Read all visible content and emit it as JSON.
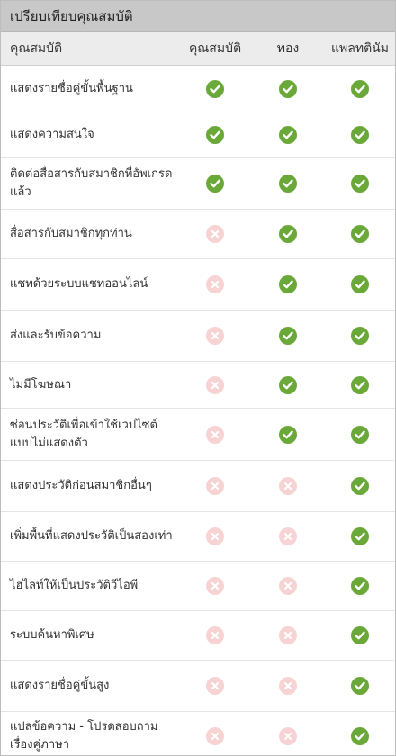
{
  "title": "เปรียบเทียบคุณสมบัติ",
  "columns": [
    "คุณสมบัติ",
    "คุณสมบัติ",
    "ทอง",
    "แพลทตินัม"
  ],
  "colors": {
    "header_bg": "#c8c8c8",
    "check": "#6aa83a",
    "cross": "#f7d3d3"
  },
  "icons": {
    "yes": "check-circle-icon",
    "no": "cross-circle-icon"
  },
  "rows": [
    {
      "label": "แสดงรายชื่อคู่ขั้นพื้นฐาน",
      "values": [
        true,
        true,
        true
      ]
    },
    {
      "label": "แสดงความสนใจ",
      "values": [
        true,
        true,
        true
      ]
    },
    {
      "label": "ติดต่อสื่อสารกับสมาชิกที่อัพเกรดแล้ว",
      "values": [
        true,
        true,
        true
      ]
    },
    {
      "label": "สื่อสารกับสมาชิกทุกท่าน",
      "values": [
        false,
        true,
        true
      ]
    },
    {
      "label": "แชทด้วยระบบแชทออนไลน์",
      "values": [
        false,
        true,
        true
      ]
    },
    {
      "label": "ส่งและรับข้อความ",
      "values": [
        false,
        true,
        true
      ]
    },
    {
      "label": "ไม่มีโฆษณา",
      "values": [
        false,
        true,
        true
      ]
    },
    {
      "label": "ซ่อนประวัติเพื่อเข้าใช้เวปไซต์แบบไม่แสดงตัว",
      "values": [
        false,
        true,
        true
      ]
    },
    {
      "label": "แสดงประวัติก่อนสมาชิกอื่นๆ",
      "values": [
        false,
        false,
        true
      ]
    },
    {
      "label": "เพิ่มพื้นที่แสดงประวัติเป็นสองเท่า",
      "values": [
        false,
        false,
        true
      ]
    },
    {
      "label": "ไฮไลท์ให้เป็นประวัติวีไอพี",
      "values": [
        false,
        false,
        true
      ]
    },
    {
      "label": "ระบบค้นหาพิเศษ",
      "values": [
        false,
        false,
        true
      ]
    },
    {
      "label": "แสดงรายชื่อคู่ขั้นสูง",
      "values": [
        false,
        false,
        true
      ]
    },
    {
      "label": "แปลข้อความ - โปรดสอบถามเรื่องคู่ภาษา",
      "values": [
        false,
        false,
        true
      ]
    }
  ]
}
